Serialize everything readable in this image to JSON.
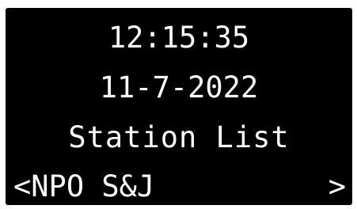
{
  "display": {
    "time": "12:15:35",
    "date": "11-7-2022",
    "menu_title": "Station List",
    "station": {
      "prev_arrow": "<",
      "name": "NPO S&J",
      "next_arrow": ">"
    },
    "colors": {
      "background": "#000000",
      "text": "#ffffff",
      "page": "#ffffff"
    }
  }
}
